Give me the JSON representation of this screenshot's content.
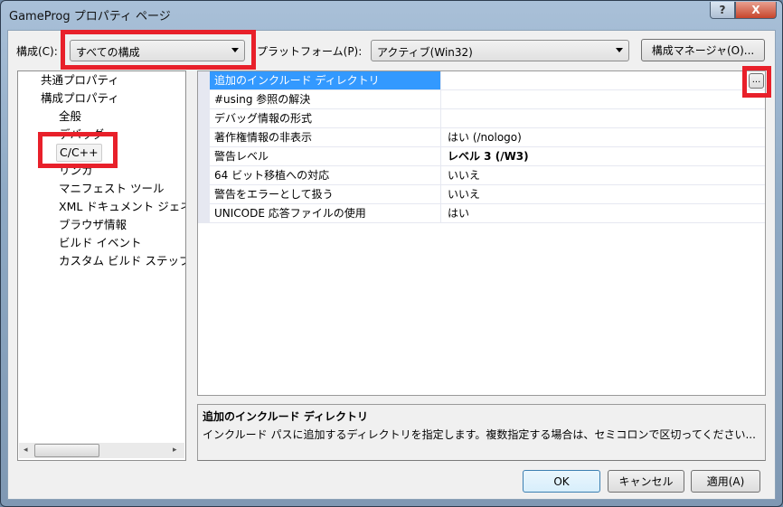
{
  "window": {
    "title": "GameProg プロパティ ページ",
    "help": "?",
    "close": "X"
  },
  "toolbar": {
    "config_label": "構成(C):",
    "config_value": "すべての構成",
    "platform_label": "プラットフォーム(P):",
    "platform_value": "アクティブ(Win32)",
    "manager_button": "構成マネージャ(O)..."
  },
  "tree": {
    "items": [
      {
        "label": "共通プロパティ",
        "level": 0
      },
      {
        "label": "構成プロパティ",
        "level": 0
      },
      {
        "label": "全般",
        "level": 1
      },
      {
        "label": "デバッグ",
        "level": 1
      },
      {
        "label": "C/C++",
        "level": 1,
        "selected": true
      },
      {
        "label": "リンカ",
        "level": 1
      },
      {
        "label": "マニフェスト ツール",
        "level": 1
      },
      {
        "label": "XML ドキュメント ジェネ",
        "level": 1
      },
      {
        "label": "ブラウザ情報",
        "level": 1
      },
      {
        "label": "ビルド イベント",
        "level": 1
      },
      {
        "label": "カスタム ビルド ステップ",
        "level": 1
      }
    ]
  },
  "grid": {
    "rows": [
      {
        "name": "追加のインクルード ディレクトリ",
        "value": "",
        "selected": true
      },
      {
        "name": "#using 参照の解決",
        "value": ""
      },
      {
        "name": "デバッグ情報の形式",
        "value": ""
      },
      {
        "name": "著作権情報の非表示",
        "value": "はい (/nologo)"
      },
      {
        "name": "警告レベル",
        "value": "レベル 3 (/W3)",
        "bold": true
      },
      {
        "name": "64 ビット移植への対応",
        "value": "いいえ"
      },
      {
        "name": "警告をエラーとして扱う",
        "value": "いいえ"
      },
      {
        "name": "UNICODE 応答ファイルの使用",
        "value": "はい"
      }
    ],
    "ellipsis": "..."
  },
  "description": {
    "title": "追加のインクルード ディレクトリ",
    "text": "インクルード パスに追加するディレクトリを指定します。複数指定する場合は、セミコロンで区切ってください..."
  },
  "buttons": {
    "ok": "OK",
    "cancel": "キャンセル",
    "apply": "適用(A)"
  },
  "highlight_color": "#e8202a"
}
